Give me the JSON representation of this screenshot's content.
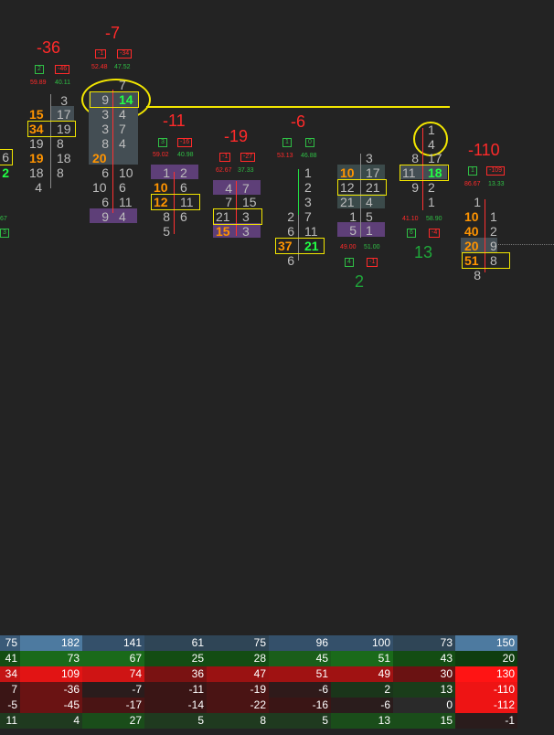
{
  "deltas": [
    "-36",
    "-7",
    "-11",
    "-19",
    "-6",
    "-110",
    "13",
    "2"
  ],
  "pcts": [
    "59.89",
    "40.11",
    "52.48",
    "47.52",
    "59.02",
    "40.98",
    "62.67",
    "37.33",
    "53.13",
    "46.88",
    "86.67",
    "13.33",
    "41.10",
    "58.90",
    "49.00",
    "51.00",
    "67"
  ],
  "badges": [
    "2",
    "-46",
    "-1",
    "-34",
    "3",
    "-16",
    "-1",
    "-27",
    "1",
    "0",
    "1",
    "-109",
    "6",
    "-4",
    "4",
    "-1",
    "3"
  ],
  "cells": [
    "6",
    "2",
    "3",
    "15",
    "17",
    "34",
    "19",
    "19",
    "8",
    "19",
    "18",
    "18",
    "8",
    "4",
    "7",
    "9",
    "14",
    "3",
    "4",
    "3",
    "7",
    "8",
    "4",
    "20",
    "6",
    "10",
    "10",
    "6",
    "6",
    "11",
    "9",
    "4",
    "1",
    "2",
    "10",
    "6",
    "12",
    "11",
    "8",
    "6",
    "5",
    "4",
    "7",
    "7",
    "15",
    "21",
    "3",
    "15",
    "3",
    "1",
    "2",
    "3",
    "2",
    "7",
    "6",
    "11",
    "37",
    "21",
    "6",
    "3",
    "10",
    "17",
    "12",
    "21",
    "21",
    "4",
    "1",
    "5",
    "5",
    "1",
    "1",
    "4",
    "8",
    "17",
    "11",
    "18",
    "9",
    "2",
    "1",
    "1",
    "10",
    "1",
    "40",
    "2",
    "20",
    "9",
    "51",
    "8",
    "8"
  ],
  "table": {
    "rows": [
      [
        "75",
        "182",
        "141",
        "61",
        "75",
        "96",
        "100",
        "73",
        "150"
      ],
      [
        "41",
        "73",
        "67",
        "25",
        "28",
        "45",
        "51",
        "43",
        "20"
      ],
      [
        "34",
        "109",
        "74",
        "36",
        "47",
        "51",
        "49",
        "30",
        "130"
      ],
      [
        "7",
        "-36",
        "-7",
        "-11",
        "-19",
        "-6",
        "2",
        "13",
        "-110"
      ],
      [
        "-5",
        "-45",
        "-17",
        "-14",
        "-22",
        "-16",
        "-6",
        "0",
        "-112"
      ],
      [
        "11",
        "4",
        "27",
        "5",
        "8",
        "5",
        "13",
        "15",
        "-1"
      ]
    ],
    "colors": [
      [
        "#3a5a78",
        "#4d7aa0",
        "#34506a",
        "#2f4556",
        "#2f4556",
        "#34506a",
        "#34506a",
        "#2f4556",
        "#4d7aa0"
      ],
      [
        "#134d13",
        "#1a6a1a",
        "#1a6a1a",
        "#134d13",
        "#134d13",
        "#1a5e1a",
        "#1a6a1a",
        "#134d13",
        "#0f3d0f"
      ],
      [
        "#c41414",
        "#e21414",
        "#cf1414",
        "#7a1212",
        "#9a1212",
        "#a01212",
        "#a01212",
        "#6a1212",
        "#ff1414"
      ],
      [
        "#3a1515",
        "#6a1313",
        "#2a1c1c",
        "#3a1515",
        "#4a1414",
        "#2f1a1a",
        "#1a351a",
        "#1a3d1a",
        "#ee1414"
      ],
      [
        "#3a1515",
        "#6a1313",
        "#4a1414",
        "#3a1515",
        "#4a1414",
        "#3a1515",
        "#2a1c1c",
        "#2a2a2a",
        "#ee1414"
      ],
      [
        "#1f3a1f",
        "#1f3a1f",
        "#1a4d1a",
        "#1f3a1f",
        "#1f3a1f",
        "#1f3a1f",
        "#1a4d1a",
        "#1a4d1a",
        "#2a1c1c"
      ]
    ]
  }
}
